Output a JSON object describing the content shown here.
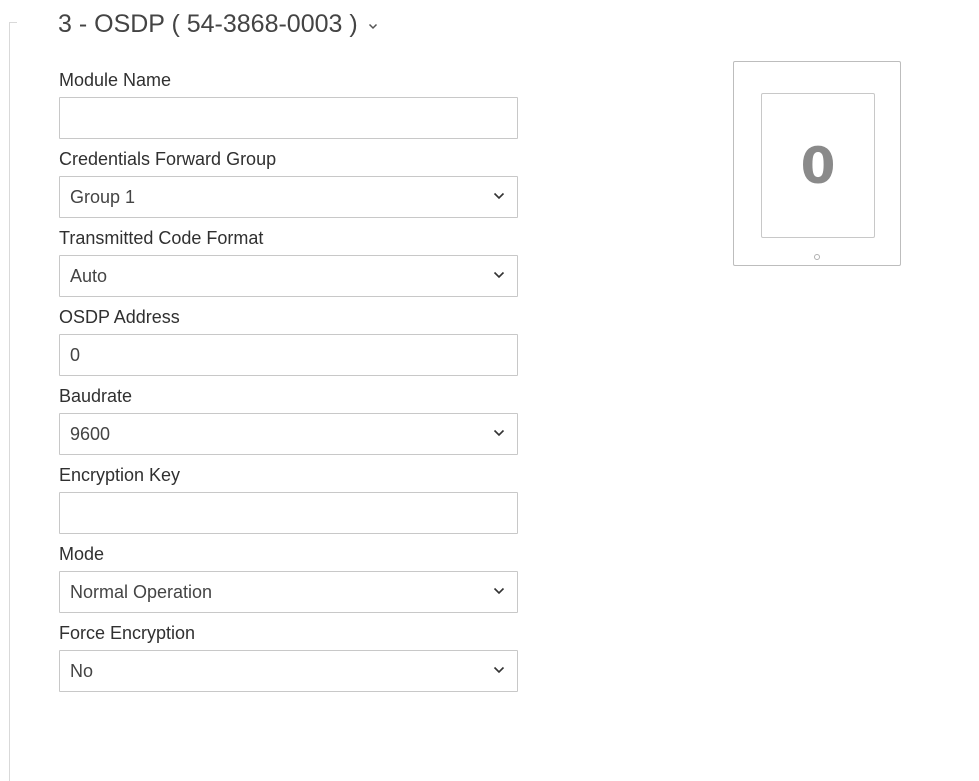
{
  "section": {
    "title": "3 - OSDP ( 54-3868-0003 )"
  },
  "fields": [
    {
      "label": "Module Name",
      "type": "text",
      "value": ""
    },
    {
      "label": "Credentials Forward Group",
      "type": "select",
      "value": "Group 1"
    },
    {
      "label": "Transmitted Code Format",
      "type": "select",
      "value": "Auto"
    },
    {
      "label": "OSDP Address",
      "type": "text",
      "value": "0"
    },
    {
      "label": "Baudrate",
      "type": "select",
      "value": "9600"
    },
    {
      "label": "Encryption Key",
      "type": "text",
      "value": ""
    },
    {
      "label": "Mode",
      "type": "select",
      "value": "Normal Operation"
    },
    {
      "label": "Force Encryption",
      "type": "select",
      "value": "No"
    }
  ],
  "device_preview": {
    "display_value": "0"
  },
  "icons": {
    "title_toggle": "chevron-down-icon",
    "select_arrow": "chevron-down-icon"
  }
}
